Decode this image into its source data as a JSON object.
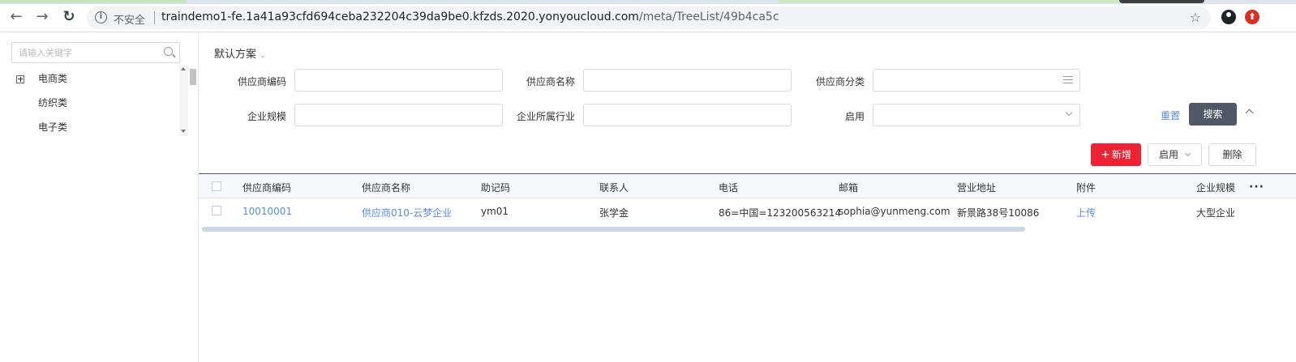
{
  "browser": {
    "insecure_label": "不安全",
    "url_host": "traindemo1-fe.1a41a93cfd694ceba232204c39da9be0.kfzds.2020.yonyoucloud.com",
    "url_path": "/meta/TreeList/49b4ca5c"
  },
  "sidebar": {
    "search_placeholder": "请输入关键字",
    "items": [
      {
        "label": "电商类",
        "expandable": true
      },
      {
        "label": "纺织类",
        "expandable": false
      },
      {
        "label": "电子类",
        "expandable": false
      }
    ]
  },
  "filter": {
    "scheme": "默认方案",
    "fields": [
      {
        "label": "供应商编码",
        "value": ""
      },
      {
        "label": "供应商名称",
        "value": ""
      },
      {
        "label": "供应商分类",
        "value": ""
      },
      {
        "label": "企业规模",
        "value": ""
      },
      {
        "label": "企业所属行业",
        "value": ""
      },
      {
        "label": "启用",
        "value": ""
      }
    ],
    "reset_label": "重置",
    "search_label": "搜索"
  },
  "toolbar": {
    "add_label": "新增",
    "enable_label": "启用",
    "delete_label": "删除"
  },
  "table": {
    "columns": [
      "供应商编码",
      "供应商名称",
      "助记码",
      "联系人",
      "电话",
      "邮箱",
      "营业地址",
      "附件",
      "企业规模"
    ],
    "rows": [
      [
        "10010001",
        "供应商010-云梦企业",
        "ym01",
        "张学金",
        "86=中国=123200563214",
        "sophia@yunmeng.com",
        "新景路38号10086",
        "上传",
        "大型企业"
      ]
    ]
  },
  "colors": {
    "accent": "#588ce9",
    "primary_dark": "#505766",
    "add_red": "#ee2233"
  }
}
